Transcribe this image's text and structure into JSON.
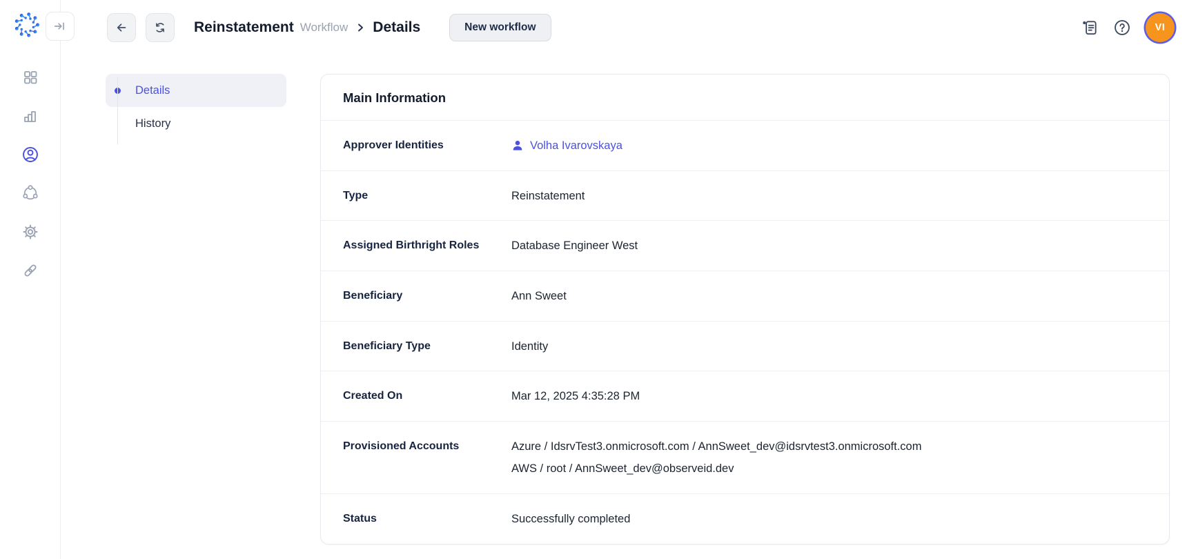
{
  "header": {
    "breadcrumb": {
      "title": "Reinstatement",
      "context": "Workflow",
      "current": "Details"
    },
    "new_workflow_label": "New workflow",
    "avatar_initials": "VI"
  },
  "sidebar": {
    "items": [
      {
        "name": "dashboard",
        "icon": "dashboard-icon",
        "active": false
      },
      {
        "name": "analytics",
        "icon": "bar-chart-icon",
        "active": false
      },
      {
        "name": "identities",
        "icon": "user-circle-icon",
        "active": true
      },
      {
        "name": "integrations",
        "icon": "nodes-ring-icon",
        "active": false
      },
      {
        "name": "settings",
        "icon": "gear-icon",
        "active": false
      },
      {
        "name": "links",
        "icon": "link-icon",
        "active": false
      }
    ]
  },
  "subnav": {
    "items": [
      {
        "label": "Details",
        "active": true
      },
      {
        "label": "History",
        "active": false
      }
    ]
  },
  "card": {
    "title": "Main Information",
    "rows": [
      {
        "label": "Approver Identities",
        "value": "Volha Ivarovskaya",
        "type": "identity-link",
        "icon": "user-icon"
      },
      {
        "label": "Type",
        "value": "Reinstatement"
      },
      {
        "label": "Assigned Birthright Roles",
        "value": "Database Engineer West"
      },
      {
        "label": "Beneficiary",
        "value": "Ann Sweet"
      },
      {
        "label": "Beneficiary Type",
        "value": "Identity"
      },
      {
        "label": "Created On",
        "value": "Mar 12, 2025 4:35:28 PM"
      },
      {
        "label": "Provisioned Accounts",
        "values": [
          "Azure / IdsrvTest3.onmicrosoft.com / AnnSweet_dev@idsrvtest3.onmicrosoft.com",
          "AWS / root / AnnSweet_dev@observeid.dev"
        ]
      },
      {
        "label": "Status",
        "value": "Successfully completed"
      }
    ]
  },
  "icons": {
    "header": [
      "collapse-sidebar-icon",
      "back-icon",
      "refresh-icon",
      "release-notes-icon",
      "help-icon"
    ],
    "row": [
      "user-icon"
    ]
  },
  "colors": {
    "accent": "#4c52e0",
    "link": "#4c52e0",
    "avatar_bg": "#f7941d",
    "avatar_ring": "#5a5fe8",
    "sidebar_icon": "#9aa3b2",
    "row_divider": "#eef0f3"
  }
}
